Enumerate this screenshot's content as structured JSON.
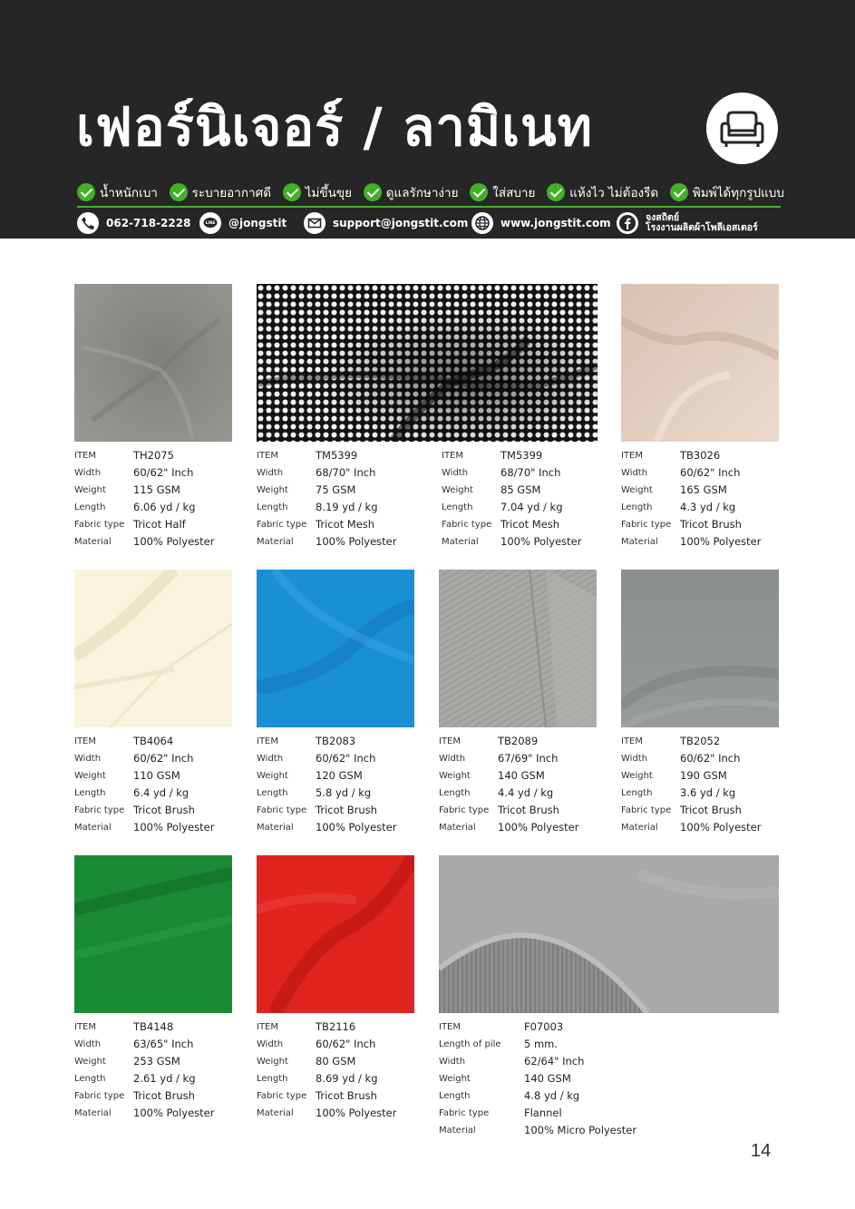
{
  "header": {
    "title": "เฟอร์นิเจอร์ / ลามิเนท",
    "title_icon": "sofa-icon",
    "features": [
      "น้ำหนักเบา",
      "ระบายอากาศดี",
      "ไม่ขึ้นขุย",
      "ดูแลรักษาง่าย",
      "ใส่สบาย",
      "แห้งไว ไม่ต้องรีด",
      "พิมพ์ได้ทุกรูปแบบ"
    ],
    "contacts": {
      "phone": "062-718-2228",
      "line": "@jongstit",
      "email": "support@jongstit.com",
      "website": "www.jongstit.com",
      "facebook_line1": "จงสถิตย์",
      "facebook_line2": "โรงงานผลิตผ้าโพลีเอสเตอร์"
    }
  },
  "colors": {
    "header_bg": "#262626",
    "accent_green": "#43b02a"
  },
  "products": [
    {
      "swatch_color": "#8e928b",
      "rows": [
        {
          "label": "ITEM",
          "value": "TH2075"
        },
        {
          "label": "Width",
          "value": "60/62\" Inch"
        },
        {
          "label": "Weight",
          "value": "115  GSM"
        },
        {
          "label": "Length",
          "value": "6.06 yd / kg"
        },
        {
          "label": "Fabric type",
          "value": "Tricot Half"
        },
        {
          "label": "Material",
          "value": "100% Polyester"
        }
      ]
    },
    {
      "swatch_color": "#1a1a1a",
      "rows": [
        {
          "label": "ITEM",
          "value": "TM5399"
        },
        {
          "label": "Width",
          "value": "68/70\" Inch"
        },
        {
          "label": "Weight",
          "value": "75 GSM"
        },
        {
          "label": "Length",
          "value": "8.19 yd / kg"
        },
        {
          "label": "Fabric type",
          "value": "Tricot Mesh"
        },
        {
          "label": "Material",
          "value": "100% Polyester"
        }
      ]
    },
    {
      "rows": [
        {
          "label": "ITEM",
          "value": "TM5399"
        },
        {
          "label": "Width",
          "value": "68/70\" Inch"
        },
        {
          "label": "Weight",
          "value": "85 GSM"
        },
        {
          "label": "Length",
          "value": "7.04 yd / kg"
        },
        {
          "label": "Fabric type",
          "value": "Tricot Mesh"
        },
        {
          "label": "Material",
          "value": "100% Polyester"
        }
      ]
    },
    {
      "swatch_color": "#e3cfc0",
      "rows": [
        {
          "label": "ITEM",
          "value": "TB3026"
        },
        {
          "label": "Width",
          "value": "60/62\" Inch"
        },
        {
          "label": "Weight",
          "value": "165 GSM"
        },
        {
          "label": "Length",
          "value": "4.3 yd / kg"
        },
        {
          "label": "Fabric type",
          "value": "Tricot Brush"
        },
        {
          "label": "Material",
          "value": "100% Polyester"
        }
      ]
    },
    {
      "swatch_color": "#f7f3dc",
      "rows": [
        {
          "label": "ITEM",
          "value": "TB4064"
        },
        {
          "label": "Width",
          "value": "60/62\" Inch"
        },
        {
          "label": "Weight",
          "value": "110 GSM"
        },
        {
          "label": "Length",
          "value": "6.4 yd / kg"
        },
        {
          "label": "Fabric type",
          "value": "Tricot Brush"
        },
        {
          "label": "Material",
          "value": "100% Polyester"
        }
      ]
    },
    {
      "swatch_color": "#1a8fd6",
      "rows": [
        {
          "label": "ITEM",
          "value": "TB2083"
        },
        {
          "label": "Width",
          "value": "60/62\" Inch"
        },
        {
          "label": "Weight",
          "value": "120 GSM"
        },
        {
          "label": "Length",
          "value": "5.8 yd / kg"
        },
        {
          "label": "Fabric type",
          "value": "Tricot Brush"
        },
        {
          "label": "Material",
          "value": "100% Polyester"
        }
      ]
    },
    {
      "swatch_color": "#a6a6a2",
      "rows": [
        {
          "label": "ITEM",
          "value": "TB2089"
        },
        {
          "label": "Width",
          "value": "67/69\" Inch"
        },
        {
          "label": "Weight",
          "value": "140 GSM"
        },
        {
          "label": "Length",
          "value": "4.4 yd / kg"
        },
        {
          "label": "Fabric type",
          "value": "Tricot Brush"
        },
        {
          "label": "Material",
          "value": "100% Polyester"
        }
      ]
    },
    {
      "swatch_color": "#8d918f",
      "rows": [
        {
          "label": "ITEM",
          "value": "TB2052"
        },
        {
          "label": "Width",
          "value": "60/62\" Inch"
        },
        {
          "label": "Weight",
          "value": "190 GSM"
        },
        {
          "label": "Length",
          "value": "3.6 yd / kg"
        },
        {
          "label": "Fabric type",
          "value": "Tricot Brush"
        },
        {
          "label": "Material",
          "value": "100% Polyester"
        }
      ]
    },
    {
      "swatch_color": "#1a8a34",
      "rows": [
        {
          "label": "ITEM",
          "value": "TB4148"
        },
        {
          "label": "Width",
          "value": "63/65\" Inch"
        },
        {
          "label": "Weight",
          "value": "253 GSM"
        },
        {
          "label": "Length",
          "value": "2.61 yd / kg"
        },
        {
          "label": "Fabric type",
          "value": "Tricot Brush"
        },
        {
          "label": "Material",
          "value": "100% Polyester"
        }
      ]
    },
    {
      "swatch_color": "#e0241f",
      "rows": [
        {
          "label": "ITEM",
          "value": "TB2116"
        },
        {
          "label": "Width",
          "value": "60/62\" Inch"
        },
        {
          "label": "Weight",
          "value": "80 GSM"
        },
        {
          "label": "Length",
          "value": "8.69 yd / kg"
        },
        {
          "label": "Fabric type",
          "value": "Tricot Brush"
        },
        {
          "label": "Material",
          "value": "100% Polyester"
        }
      ]
    },
    {
      "swatch_color": "#a5a5a5",
      "rows": [
        {
          "label": "ITEM",
          "value": "F07003"
        },
        {
          "label": "Length of pile",
          "value": "5 mm."
        },
        {
          "label": "Width",
          "value": "62/64\" Inch"
        },
        {
          "label": "Weight",
          "value": "140 GSM"
        },
        {
          "label": "Length",
          "value": "4.8 yd / kg"
        },
        {
          "label": "Fabric type",
          "value": "Flannel"
        },
        {
          "label": "Material",
          "value": "100% Micro Polyester"
        }
      ]
    }
  ],
  "page_number": "14"
}
